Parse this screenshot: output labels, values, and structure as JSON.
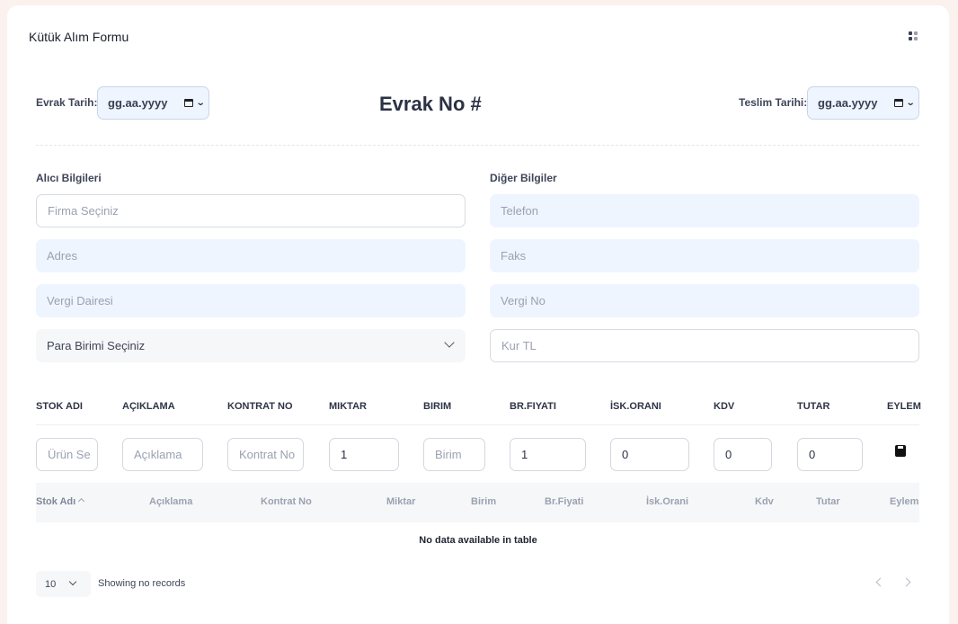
{
  "card": {
    "title": "Kütük Alım Formu"
  },
  "header": {
    "evrak_tarih_label": "Evrak Tarih:",
    "evrak_tarih_value": "gg.aa.yyyy",
    "evrak_no": "Evrak No #",
    "teslim_tarih_label": "Teslim Tarihi:",
    "teslim_tarih_value": "gg.aa.yyyy"
  },
  "alici": {
    "title": "Alıcı Bilgileri",
    "firma_placeholder": "Firma Seçiniz",
    "adres_placeholder": "Adres",
    "vergi_dairesi_placeholder": "Vergi Dairesi",
    "para_birimi": "Para Birimi Seçiniz"
  },
  "diger": {
    "title": "Diğer Bilgiler",
    "telefon_placeholder": "Telefon",
    "faks_placeholder": "Faks",
    "vergi_no_placeholder": "Vergi No",
    "kur_placeholder": "Kur TL"
  },
  "entry": {
    "headers": [
      "STOK ADI",
      "AÇIKLAMA",
      "KONTRAT NO",
      "MIKTAR",
      "BIRIM",
      "BR.FIYATI",
      "İSK.ORANI",
      "KDV",
      "TUTAR",
      "EYLEM"
    ],
    "stok_placeholder": "Ürün Se",
    "aciklama_placeholder": "Açıklama",
    "kontrat_placeholder": "Kontrat No",
    "miktar": "1",
    "birim_placeholder": "Birim",
    "br_fiyati": "1",
    "isk_orani": "0",
    "kdv": "0",
    "tutar": "0"
  },
  "table": {
    "columns": [
      "Stok Adı",
      "Açıklama",
      "Kontrat No",
      "Miktar",
      "Birim",
      "Br.Fiyati",
      "İsk.Orani",
      "Kdv",
      "Tutar",
      "Eylem"
    ],
    "empty_text": "No data available in table",
    "page_size": "10",
    "showing": "Showing no records"
  }
}
